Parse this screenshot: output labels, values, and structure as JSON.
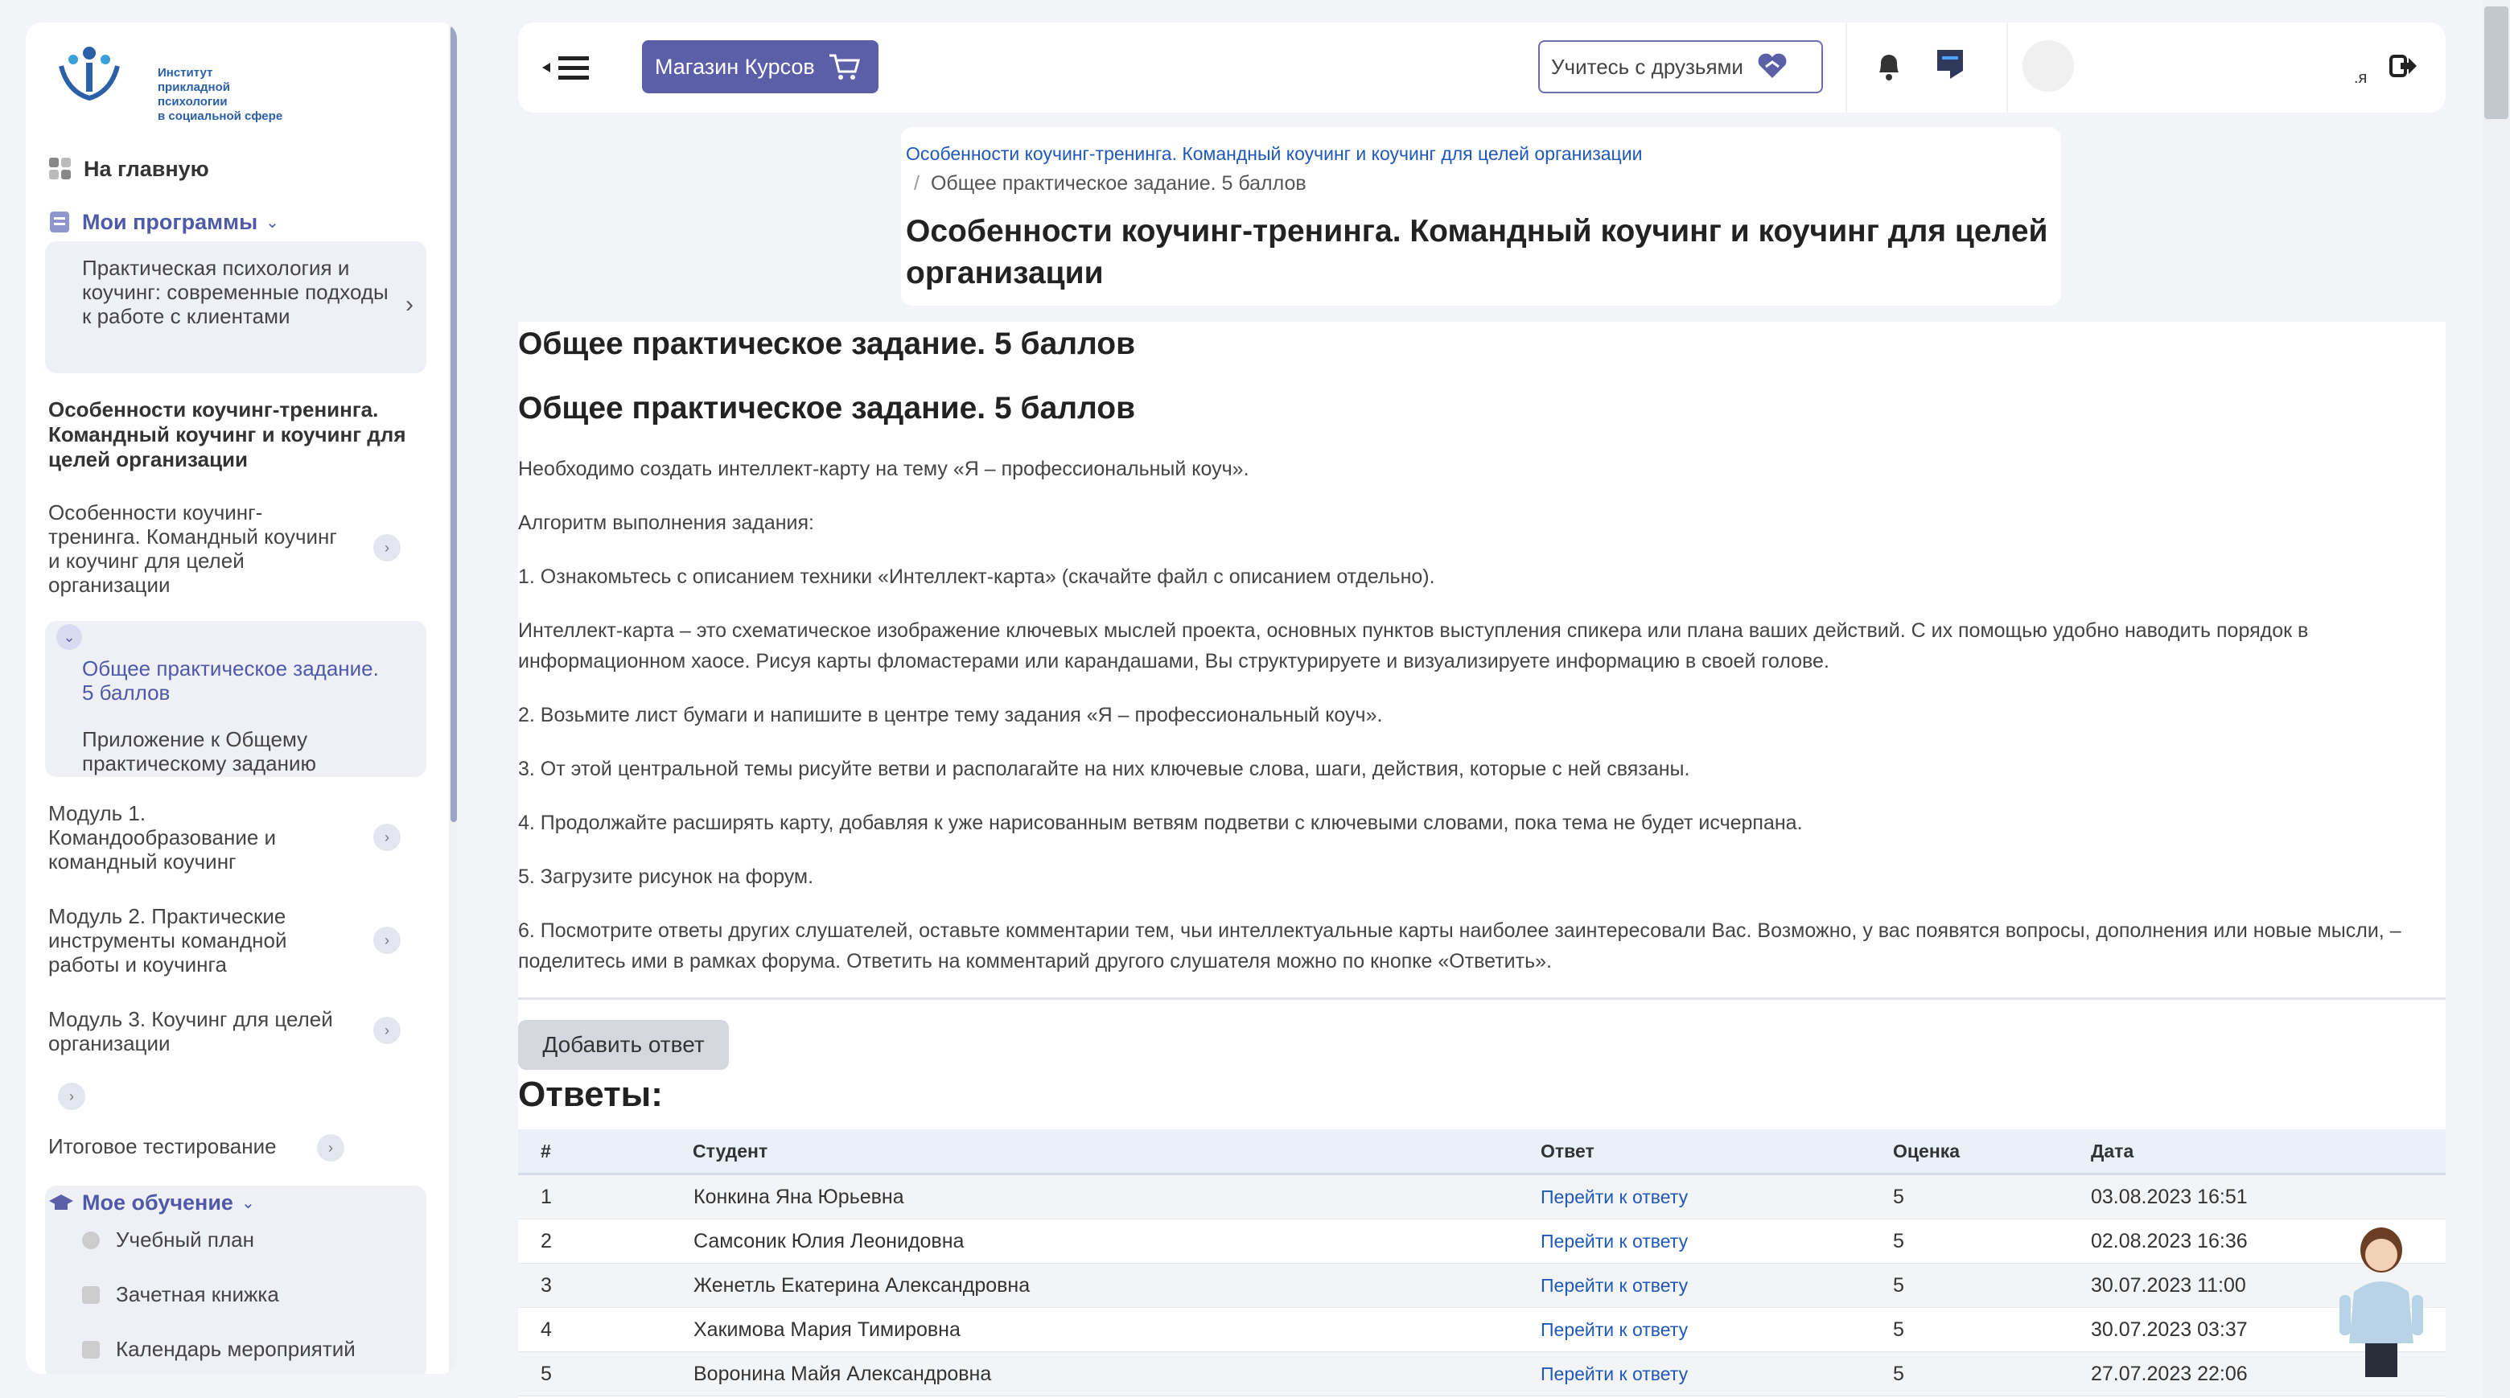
{
  "sidebar": {
    "logo_lines": [
      "Институт",
      "прикладной психологии",
      "в социальной сфере"
    ],
    "home": "На главную",
    "my_programs": "Мои программы",
    "program_card": "Практическая психология и коучинг: современные подходы к работе с клиентами",
    "course_title": "Особенности коучинг-тренинга. Командный коучинг и коучинг для целей организации",
    "section_main": "Особенности коучинг-тренинга. Командный коучинг и коучинг для целей организации",
    "sub_items": [
      "Общее практическое задание. 5 баллов",
      "Приложение к Общему практическому заданию"
    ],
    "modules": [
      "Модуль 1. Командообразование и командный коучинг",
      "Модуль 2. Практические инструменты командной работы и коучинга",
      "Модуль 3. Коучинг для целей организации"
    ],
    "final_test": "Итоговое тестирование",
    "my_learning": "Мое обучение",
    "learning_items": [
      "Учебный план",
      "Зачетная книжка",
      "Календарь мероприятий"
    ]
  },
  "header": {
    "shop_label": "Магазин Курсов",
    "friends_label": "Учитесь с друзьями",
    "user_short": ".я"
  },
  "breadcrumb": {
    "link": "Особенности коучинг-тренинга. Командный коучинг и коучинг для целей организации",
    "current": "Общее практическое задание. 5 баллов",
    "page_title": "Особенности коучинг-тренинга. Командный коучинг и коучинг для целей организации"
  },
  "content": {
    "heading1": "Общее практическое задание. 5 баллов",
    "heading2": "Общее практическое задание. 5 баллов",
    "paragraphs": [
      "Необходимо создать интеллект-карту на тему «Я – профессиональный коуч».",
      "Алгоритм выполнения задания:",
      "1. Ознакомьтесь с описанием техники «Интеллект-карта» (скачайте файл с описанием отдельно).",
      "Интеллект-карта – это схематическое изображение ключевых мыслей проекта, основных пунктов выступления спикера или плана ваших действий. С их помощью удобно наводить порядок в информационном хаосе. Рисуя карты фломастерами или карандашами, Вы структурируете и визуализируете информацию в своей голове.",
      "2. Возьмите лист бумаги и напишите в центре тему задания «Я – профессиональный коуч».",
      "3. От этой центральной темы рисуйте ветви и располагайте на них ключевые слова, шаги, действия, которые с ней связаны.",
      "4. Продолжайте расширять карту, добавляя к уже нарисованным ветвям подветви с ключевыми словами, пока тема не будет исчерпана.",
      "5. Загрузите рисунок на форум.",
      "6. Посмотрите ответы других слушателей, оставьте комментарии тем, чьи интеллектуальные карты наиболее заинтересовали Вас. Возможно, у вас появятся вопросы, дополнения или новые мысли, – поделитесь ими в рамках форума. Ответить на комментарий другого слушателя можно по кнопке «Ответить»."
    ],
    "add_answer": "Добавить ответ",
    "answers_title": "Ответы:"
  },
  "table": {
    "columns": [
      "#",
      "Студент",
      "Ответ",
      "Оценка",
      "Дата"
    ],
    "link_label": "Перейти к ответу",
    "rows": [
      {
        "n": "1",
        "student": "Конкина Яна Юрьевна",
        "grade": "5",
        "date": "03.08.2023 16:51"
      },
      {
        "n": "2",
        "student": "Самсоник Юлия Леонидовна",
        "grade": "5",
        "date": "02.08.2023 16:36"
      },
      {
        "n": "3",
        "student": "Женетль Екатерина Александровна",
        "grade": "5",
        "date": "30.07.2023 11:00"
      },
      {
        "n": "4",
        "student": "Хакимова Мария Тимировна",
        "grade": "5",
        "date": "30.07.2023 03:37"
      },
      {
        "n": "5",
        "student": "Воронина Майя Александровна",
        "grade": "5",
        "date": "27.07.2023 22:06"
      }
    ]
  },
  "colors": {
    "accent": "#5b5fa8",
    "link": "#2058b8",
    "brand": "#2b5fa7"
  }
}
